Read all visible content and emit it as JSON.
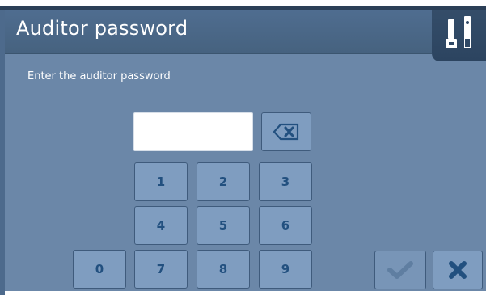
{
  "header": {
    "title": "Auditor password"
  },
  "prompt": {
    "text": "Enter the auditor password"
  },
  "password_input": {
    "value": ""
  },
  "keypad": {
    "keys": [
      "1",
      "2",
      "3",
      "4",
      "5",
      "6",
      "0",
      "7",
      "8",
      "9"
    ]
  },
  "icons": {
    "status": "usb-ethernet-status-icon",
    "backspace": "backspace-icon",
    "confirm": "checkmark-icon",
    "cancel": "close-x-icon"
  },
  "colors": {
    "panel": "#6b87a8",
    "header": "#4f6d90",
    "key": "#7f9dc0",
    "key_text": "#22507f",
    "text": "#ffffff"
  }
}
